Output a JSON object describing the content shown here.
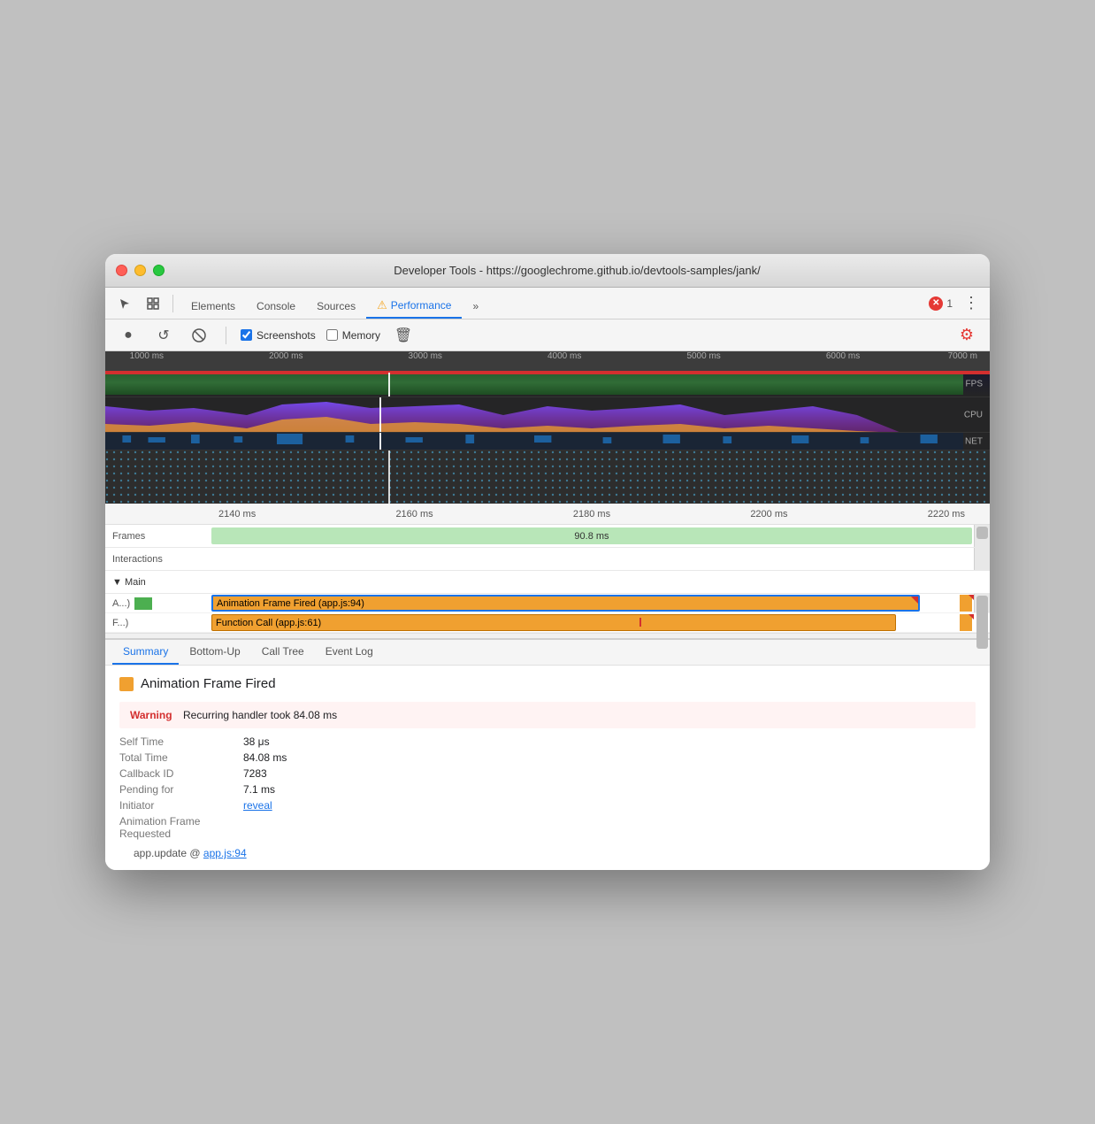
{
  "window": {
    "title": "Developer Tools - https://googlechrome.github.io/devtools-samples/jank/"
  },
  "tabs": {
    "items": [
      {
        "label": "Elements",
        "active": false
      },
      {
        "label": "Console",
        "active": false
      },
      {
        "label": "Sources",
        "active": false
      },
      {
        "label": "Performance",
        "active": true
      },
      {
        "label": "»",
        "active": false
      }
    ],
    "error_count": "1",
    "more_icon": "⋮"
  },
  "toolbar": {
    "record_label": "●",
    "reload_label": "↺",
    "clear_label": "🚫",
    "screenshots_label": "Screenshots",
    "memory_label": "Memory",
    "trash_label": "🗑",
    "settings_label": "⚙"
  },
  "overview": {
    "ruler_marks": [
      "1000 ms",
      "2000 ms",
      "3000 ms",
      "4000 ms",
      "5000 ms",
      "6000 ms",
      "7000 m"
    ],
    "fps_label": "FPS",
    "cpu_label": "CPU",
    "net_label": "NET"
  },
  "detail": {
    "ruler_marks": [
      "2140 ms",
      "2160 ms",
      "2180 ms",
      "2200 ms",
      "2220 ms"
    ],
    "tracks": [
      {
        "label": "Frames",
        "content": "90.8 ms"
      },
      {
        "label": "Interactions"
      },
      {
        "label": "▼ Main"
      }
    ],
    "flames": [
      {
        "label": "A...)",
        "bar_text": "Animation Frame Fired (app.js:94)",
        "bar_left": "0%",
        "bar_width": "92%",
        "type": "orange"
      },
      {
        "label": "F...)",
        "bar_text": "Function Call (app.js:61)",
        "bar_left": "0%",
        "bar_width": "89%",
        "type": "orange"
      }
    ]
  },
  "bottom_tabs": [
    {
      "label": "Summary",
      "active": true
    },
    {
      "label": "Bottom-Up",
      "active": false
    },
    {
      "label": "Call Tree",
      "active": false
    },
    {
      "label": "Event Log",
      "active": false
    }
  ],
  "summary": {
    "title": "Animation Frame Fired",
    "color": "#f0a030",
    "warning_label": "Warning",
    "warning_text": "Recurring handler took 84.08 ms",
    "self_time_key": "Self Time",
    "self_time_val": "38 μs",
    "total_time_key": "Total Time",
    "total_time_val": "84.08 ms",
    "callback_id_key": "Callback ID",
    "callback_id_val": "7283",
    "pending_for_key": "Pending for",
    "pending_for_val": "7.1 ms",
    "initiator_key": "Initiator",
    "initiator_link": "reveal",
    "frame_req_key": "Animation Frame Requested",
    "stack_text": "app.update @",
    "stack_link": "app.js:94"
  }
}
